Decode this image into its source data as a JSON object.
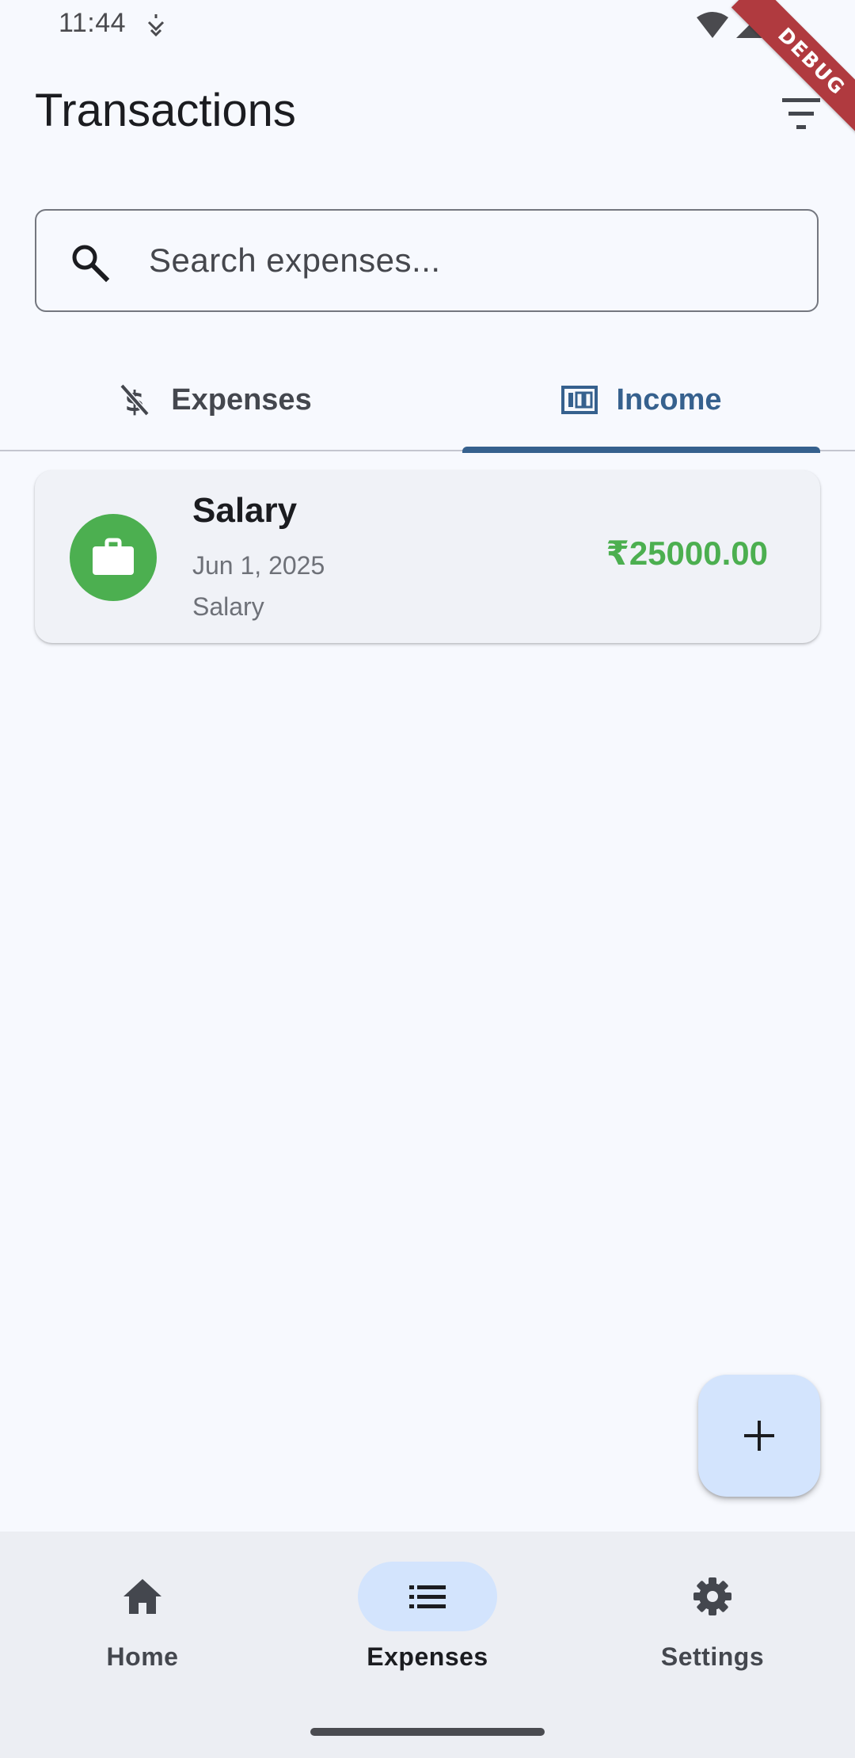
{
  "status_bar": {
    "time": "11:44",
    "icons": [
      "do-not-disturb-icon",
      "wifi-icon",
      "cellular-signal-icon"
    ]
  },
  "debug_banner": "DEBUG",
  "app_bar": {
    "title": "Transactions",
    "filter_icon": "filter-icon"
  },
  "search": {
    "placeholder": "Search expenses...",
    "value": "",
    "icon": "search-icon"
  },
  "tabs": [
    {
      "label": "Expenses",
      "icon": "money-off-icon",
      "selected": false
    },
    {
      "label": "Income",
      "icon": "money-icon",
      "selected": true
    }
  ],
  "transactions": [
    {
      "title": "Salary",
      "date": "Jun 1, 2025",
      "category": "Salary",
      "amount": "₹25000.00",
      "icon": "briefcase-icon"
    }
  ],
  "fab": {
    "icon": "add-icon"
  },
  "bottom_nav": [
    {
      "label": "Home",
      "icon": "home-icon",
      "selected": false
    },
    {
      "label": "Expenses",
      "icon": "list-icon",
      "selected": true
    },
    {
      "label": "Settings",
      "icon": "settings-icon",
      "selected": false
    }
  ],
  "colors": {
    "background": "#f7f9fe",
    "primary": "#36618e",
    "income_green": "#4caf50",
    "nav_background": "#eceef3",
    "indicator": "#d3e4fd",
    "debug_red": "#b03a3f"
  }
}
